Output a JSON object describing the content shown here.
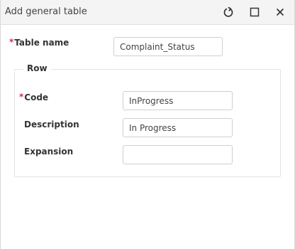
{
  "dialog": {
    "title": "Add general table"
  },
  "table_name": {
    "label": "Table name",
    "required_mark": "*",
    "value": "Complaint_Status"
  },
  "row": {
    "legend": "Row",
    "code": {
      "label": "Code",
      "required_mark": "*",
      "value": "InProgress"
    },
    "description": {
      "label": "Description",
      "value": "In Progress"
    },
    "expansion": {
      "label": "Expansion",
      "value": ""
    }
  }
}
